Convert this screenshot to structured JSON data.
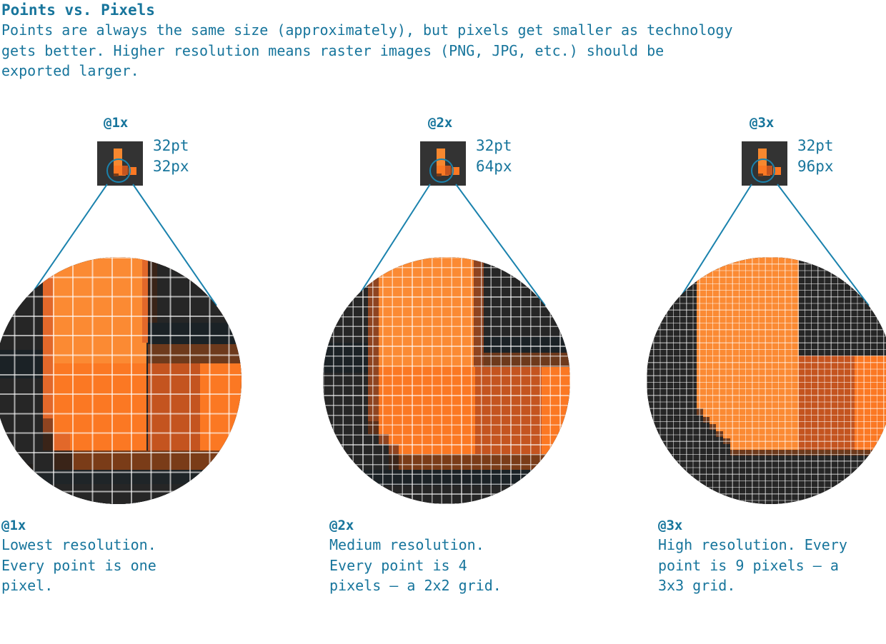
{
  "header": {
    "title": "Points vs. Pixels",
    "body": "Points are always the same size (approximately), but pixels get smaller as technology\ngets better. Higher resolution means raster images (PNG, JPG, etc.) should be\nexported larger."
  },
  "colors": {
    "teal": "#17759c",
    "teal_line": "#1a82ad",
    "orange_light": "#fb8a33",
    "orange": "#fb7823",
    "orange_mid": "#e2682a",
    "brown": "#6e3a1c",
    "brown_dark": "#3a2418",
    "dark": "#262626",
    "dark_blue": "#1b2226",
    "thumb_bg": "#333333",
    "grid_line": "#ffffff"
  },
  "columns": [
    {
      "scale_label": "@1x",
      "pt_label": "32pt",
      "px_label": "32px",
      "caption_title": "@1x",
      "caption_body": "Lowest resolution.\nEvery point is one\npixel.",
      "grid_density": 1,
      "magnifier_icon": "magnifier-circle-icon"
    },
    {
      "scale_label": "@2x",
      "pt_label": "32pt",
      "px_label": "64px",
      "caption_title": "@2x",
      "caption_body": "Medium resolution.\nEvery point is 4\npixels – a 2x2 grid.",
      "grid_density": 2,
      "magnifier_icon": "magnifier-circle-icon"
    },
    {
      "scale_label": "@3x",
      "pt_label": "32pt",
      "px_label": "96px",
      "caption_title": "@3x",
      "caption_body": "High resolution. Every\npoint is 9 pixels – a\n3x3 grid.",
      "grid_density": 3,
      "magnifier_icon": "magnifier-circle-icon"
    }
  ]
}
